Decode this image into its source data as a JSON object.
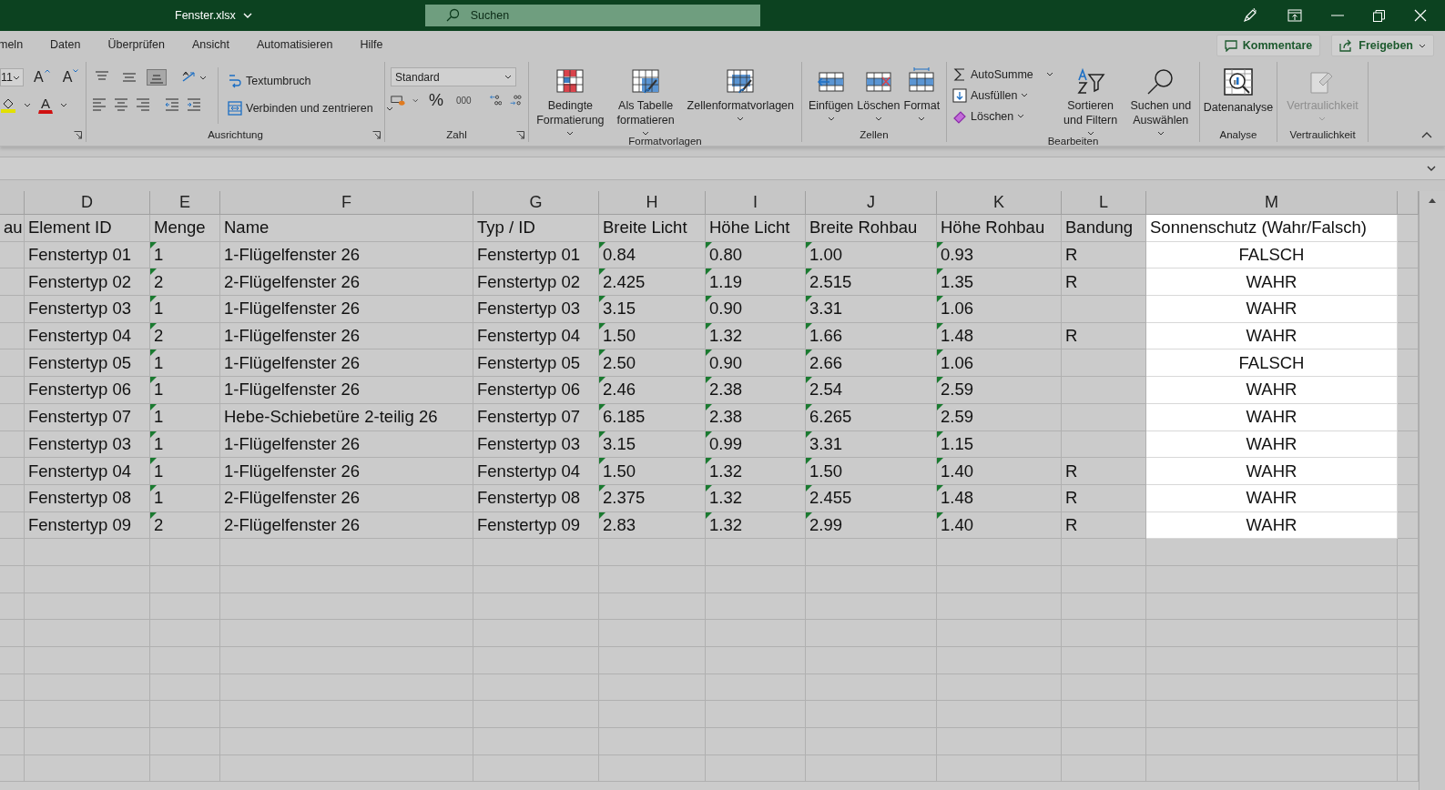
{
  "window": {
    "title": "Fenster.xlsx",
    "search": {
      "placeholder": "Suchen"
    }
  },
  "ribbon_tabs": [
    "meln",
    "Daten",
    "Überprüfen",
    "Ansicht",
    "Automatisieren",
    "Hilfe"
  ],
  "ribbon_actions": {
    "comments": "Kommentare",
    "share": "Freigeben"
  },
  "font_group": {
    "font_size": "11",
    "grow_glyph": "A",
    "shrink_glyph": "A",
    "color_glyph": "A"
  },
  "alignment_group": {
    "label": "Ausrichtung",
    "wrap": "Textumbruch",
    "merge": "Verbinden und zentrieren",
    "vertical_align": [
      {
        "selected": false
      },
      {
        "selected": false
      },
      {
        "selected": true
      }
    ]
  },
  "number_group": {
    "label": "Zahl",
    "format": "Standard",
    "percent": "%",
    "thousands": "000"
  },
  "styles_group": {
    "label": "Formatvorlagen",
    "buttons": [
      "Bedingte Formatierung",
      "Als Tabelle formatieren",
      "Zellenformatvorlagen"
    ]
  },
  "cells_group": {
    "label": "Zellen",
    "buttons": [
      "Einfügen",
      "Löschen",
      "Format"
    ]
  },
  "editing_group": {
    "label": "Bearbeiten",
    "small_buttons": [
      "AutoSumme",
      "Ausfüllen",
      "Löschen"
    ],
    "large_buttons": [
      "Sortieren und Filtern",
      "Suchen und Auswählen"
    ]
  },
  "analysis_group": {
    "label": "Analyse",
    "button": "Datenanalyse"
  },
  "sensitivity_group": {
    "label": "Vertraulichkeit",
    "button": "Vertraulichkeit",
    "disabled": true
  },
  "sheet": {
    "columns": [
      {
        "kind": "text",
        "flagged": false,
        "highlighted": false
      },
      {
        "letter": "D",
        "kind": "text",
        "flagged": false,
        "highlighted": false
      },
      {
        "letter": "E",
        "kind": "text",
        "flagged": true,
        "highlighted": false
      },
      {
        "letter": "F",
        "kind": "text",
        "flagged": false,
        "highlighted": false
      },
      {
        "letter": "G",
        "kind": "text",
        "flagged": false,
        "highlighted": false
      },
      {
        "letter": "H",
        "kind": "text",
        "flagged": true,
        "highlighted": false
      },
      {
        "letter": "I",
        "kind": "text",
        "flagged": true,
        "highlighted": false
      },
      {
        "letter": "J",
        "kind": "text",
        "flagged": true,
        "highlighted": false
      },
      {
        "letter": "K",
        "kind": "text",
        "flagged": true,
        "highlighted": false
      },
      {
        "letter": "L",
        "kind": "text",
        "flagged": false,
        "highlighted": false
      },
      {
        "letter": "M",
        "kind": "boolean",
        "flagged": false,
        "highlighted": true
      }
    ],
    "header_row": [
      "au",
      "Element ID",
      "Menge",
      "Name",
      "Typ / ID",
      "Breite Licht",
      "Höhe Licht",
      "Breite Rohbau",
      "Höhe Rohbau",
      "Bandung",
      "Sonnenschutz (Wahr/Falsch)"
    ],
    "rows": [
      [
        "",
        "Fenstertyp 01",
        "1",
        "1-Flügelfenster 26",
        "Fenstertyp 01",
        "0.84",
        "0.80",
        "1.00",
        "0.93",
        "R",
        "FALSCH"
      ],
      [
        "",
        "Fenstertyp 02",
        "2",
        "2-Flügelfenster 26",
        "Fenstertyp 02",
        "2.425",
        "1.19",
        "2.515",
        "1.35",
        "R",
        "WAHR"
      ],
      [
        "",
        "Fenstertyp 03",
        "1",
        "1-Flügelfenster 26",
        "Fenstertyp 03",
        "3.15",
        "0.90",
        "3.31",
        "1.06",
        "",
        "WAHR"
      ],
      [
        "",
        "Fenstertyp 04",
        "2",
        "1-Flügelfenster 26",
        "Fenstertyp 04",
        "1.50",
        "1.32",
        "1.66",
        "1.48",
        "R",
        "WAHR"
      ],
      [
        "",
        "Fenstertyp 05",
        "1",
        "1-Flügelfenster 26",
        "Fenstertyp 05",
        "2.50",
        "0.90",
        "2.66",
        "1.06",
        "",
        "FALSCH"
      ],
      [
        "",
        "Fenstertyp 06",
        "1",
        "1-Flügelfenster 26",
        "Fenstertyp 06",
        "2.46",
        "2.38",
        "2.54",
        "2.59",
        "",
        "WAHR"
      ],
      [
        "",
        "Fenstertyp 07",
        "1",
        "Hebe-Schiebetüre 2-teilig 26",
        "Fenstertyp 07",
        "6.185",
        "2.38",
        "6.265",
        "2.59",
        "",
        "WAHR"
      ],
      [
        "",
        "Fenstertyp 03",
        "1",
        "1-Flügelfenster 26",
        "Fenstertyp 03",
        "3.15",
        "0.99",
        "3.31",
        "1.15",
        "",
        "WAHR"
      ],
      [
        "",
        "Fenstertyp 04",
        "1",
        "1-Flügelfenster 26",
        "Fenstertyp 04",
        "1.50",
        "1.32",
        "1.50",
        "1.40",
        "R",
        "WAHR"
      ],
      [
        "",
        "Fenstertyp 08",
        "1",
        "2-Flügelfenster 26",
        "Fenstertyp 08",
        "2.375",
        "1.32",
        "2.455",
        "1.48",
        "R",
        "WAHR"
      ],
      [
        "",
        "Fenstertyp 09",
        "2",
        "2-Flügelfenster 26",
        "Fenstertyp 09",
        "2.83",
        "1.32",
        "2.99",
        "1.40",
        "R",
        "WAHR"
      ]
    ]
  }
}
